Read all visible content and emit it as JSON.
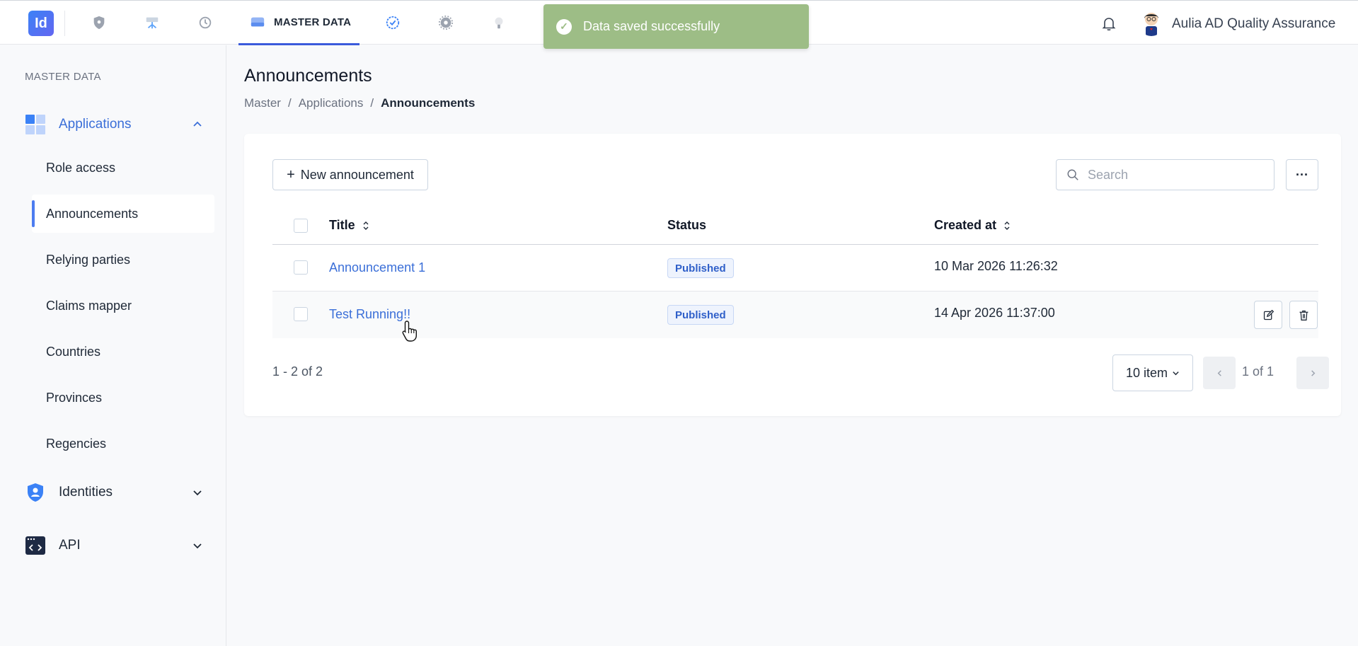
{
  "header": {
    "logo_text": "Id",
    "active_nav_label": "MASTER DATA",
    "user_name": "Aulia AD Quality Assurance",
    "nav_icons": [
      "shield-icon",
      "network-icon",
      "history-icon",
      "database-icon",
      "badge-check-icon",
      "gear-icon",
      "lightbulb-icon"
    ]
  },
  "toast": {
    "message": "Data saved successfully"
  },
  "sidebar": {
    "section_title": "MASTER DATA",
    "groups": [
      {
        "label": "Applications",
        "expanded": true
      },
      {
        "label": "Identities",
        "expanded": false
      },
      {
        "label": "API",
        "expanded": false
      }
    ],
    "items": [
      {
        "label": "Role access"
      },
      {
        "label": "Announcements",
        "active": true
      },
      {
        "label": "Relying parties"
      },
      {
        "label": "Claims mapper"
      },
      {
        "label": "Countries"
      },
      {
        "label": "Provinces"
      },
      {
        "label": "Regencies"
      }
    ]
  },
  "main": {
    "title": "Announcements",
    "breadcrumb": [
      "Master",
      "Applications",
      "Announcements"
    ],
    "new_button_label": "New announcement",
    "search_placeholder": "Search",
    "more_button_label": "···",
    "table": {
      "columns": [
        "Title",
        "Status",
        "Created at"
      ],
      "rows": [
        {
          "title": "Announcement 1",
          "status": "Published",
          "created_at": "10 Mar 2026 11:26:32"
        },
        {
          "title": "Test Running!!",
          "status": "Published",
          "created_at": "14 Apr 2026 11:37:00"
        }
      ]
    },
    "pagination": {
      "count_text": "1 - 2 of 2",
      "page_size": "10 item",
      "page_text": "1 of 1"
    }
  },
  "colors": {
    "accent": "#3b5bdb",
    "link": "#3b6fd8",
    "toast_bg": "#9dbd86",
    "badge_text": "#2f5fc9"
  }
}
